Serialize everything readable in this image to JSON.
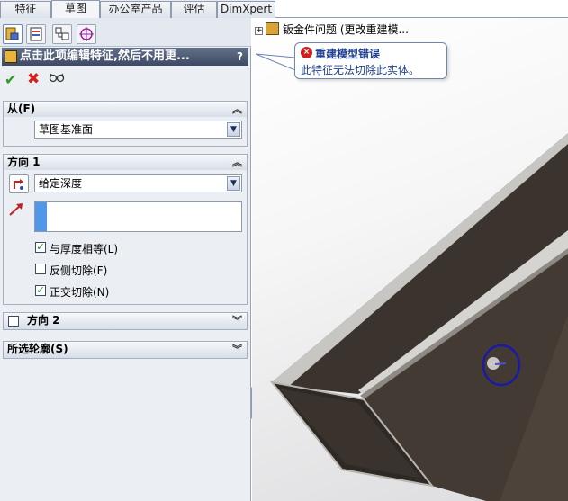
{
  "tabs": [
    "特征",
    "草图",
    "办公室产品",
    "评估",
    "DimXpert"
  ],
  "active_tab": "草图",
  "property_manager": {
    "header_text": "点击此项编辑特征,然后不用更...",
    "help": "?",
    "ok_icon": "check-icon",
    "cancel_icon": "x-icon",
    "preview_icon": "glasses-icon"
  },
  "from_group": {
    "title": "从(F)",
    "selected": "草图基准面"
  },
  "direction1": {
    "title": "方向 1",
    "end_condition": "给定深度",
    "depth_value": "",
    "checkboxes": [
      {
        "label": "与厚度相等(L)",
        "checked": true
      },
      {
        "label": "反侧切除(F)",
        "checked": false
      },
      {
        "label": "正交切除(N)",
        "checked": true
      }
    ]
  },
  "direction2": {
    "title": "方向 2",
    "checked": false
  },
  "contours": {
    "title": "所选轮廓(S)"
  },
  "tree": {
    "item_label": "钣金件问题 (更改重建模..."
  },
  "tooltip": {
    "title": "重建模型错误",
    "body": "此特征无法切除此实体。"
  },
  "colors": {
    "header_bg": "#4a5670",
    "ok_green": "#2c9a27",
    "cancel_red": "#d2201d",
    "tooltip_text": "#1f3f8f",
    "model_dark": "#3f3630",
    "model_edge": "#b9b6b0"
  }
}
